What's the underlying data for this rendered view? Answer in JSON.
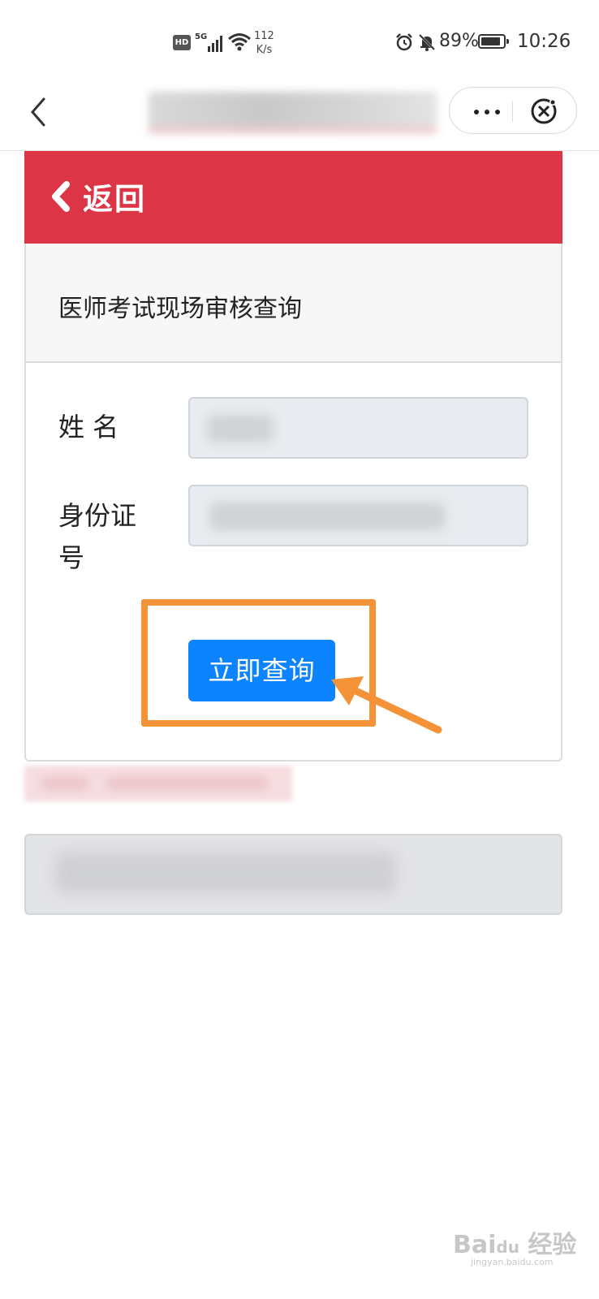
{
  "status_bar": {
    "hd": "HD",
    "network": "5G",
    "speed_value": "112",
    "speed_unit": "K/s",
    "battery_percent": "89%",
    "battery_level": 0.89,
    "time": "10:26"
  },
  "navbar": {
    "back_icon": "chevron-left-icon",
    "more_icon": "more-dots-icon",
    "close_icon": "mini-program-close-icon"
  },
  "header": {
    "back_label": "返回",
    "color": "#dc3545"
  },
  "card": {
    "title": "医师考试现场审核查询"
  },
  "form": {
    "name_label": "姓 名",
    "id_label_line1": "身份证",
    "id_label_line2": "号",
    "query_button": "立即查询",
    "button_color": "#0d84ff"
  },
  "annotation": {
    "color": "#f39237"
  },
  "watermark": {
    "text": "Bai du 经验",
    "sub": "jingyan.baidu.com"
  }
}
